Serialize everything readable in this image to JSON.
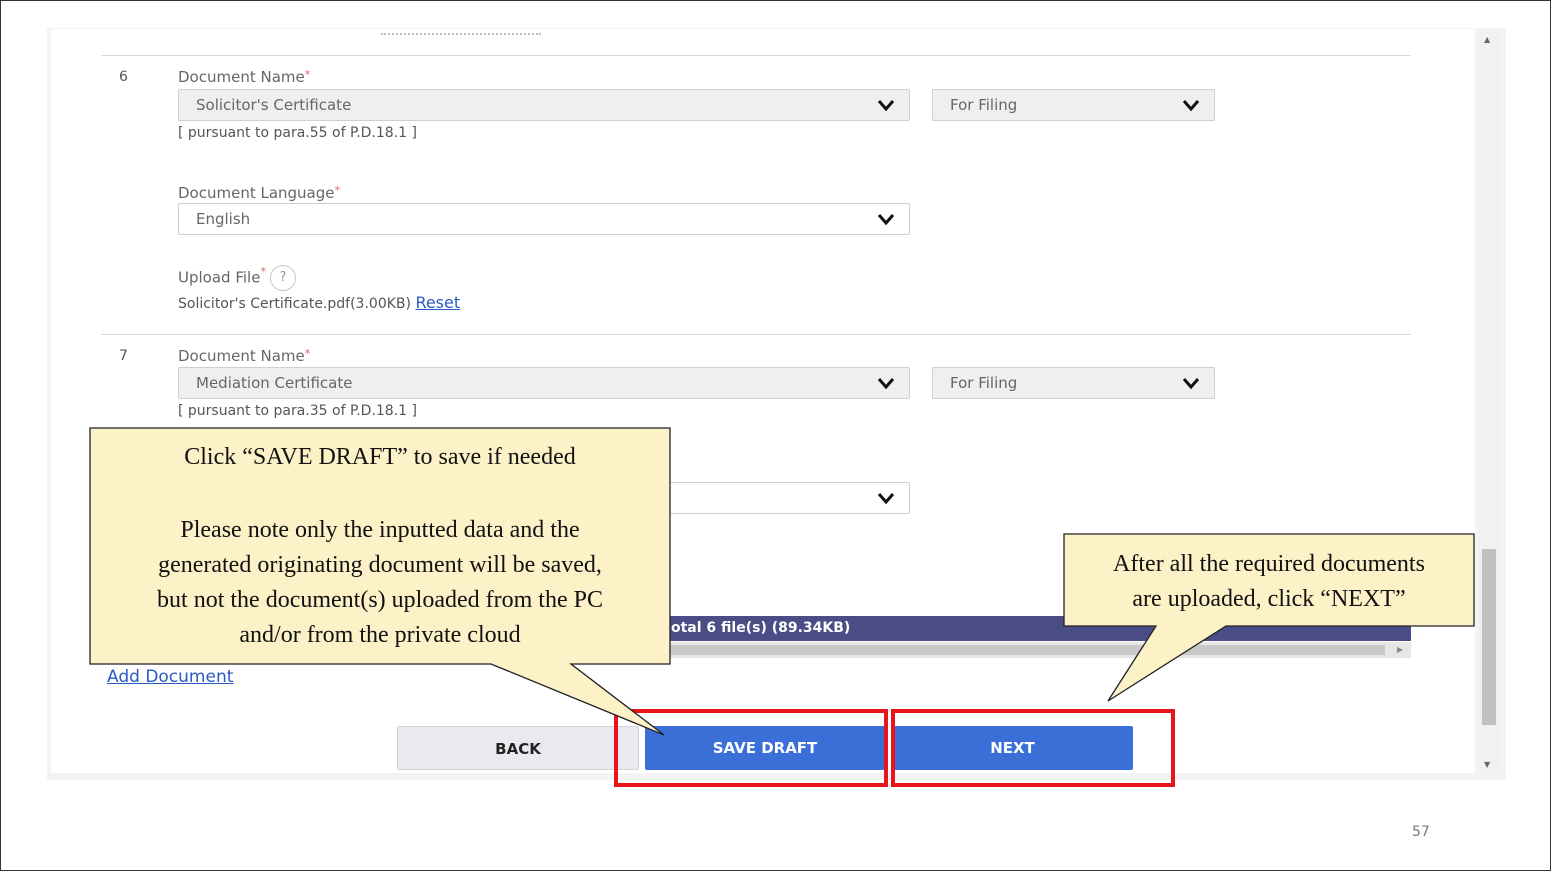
{
  "slide": {
    "page_number": "57"
  },
  "form": {
    "docs": [
      {
        "index": "6",
        "name_label": "Document Name",
        "name_value": "Solicitor's Certificate",
        "purpose_value": "For Filing",
        "note": "[ pursuant to para.55 of P.D.18.1 ]",
        "language_label": "Document Language",
        "language_value": "English",
        "upload_label": "Upload File",
        "help_glyph": "?",
        "file_text": "Solicitor's Certificate.pdf(3.00KB)",
        "reset_label": "Reset"
      },
      {
        "index": "7",
        "name_label": "Document Name",
        "name_value": "Mediation Certificate",
        "purpose_value": "For Filing",
        "note": "[ pursuant to para.35 of P.D.18.1 ]"
      }
    ],
    "required_marker": "*",
    "total_label": "otal 6 file(s) (89.34KB)",
    "add_document_label": "Add Document"
  },
  "buttons": {
    "back": "BACK",
    "save_draft": "SAVE DRAFT",
    "next": "NEXT"
  },
  "callouts": {
    "save": {
      "line1": "Click “SAVE DRAFT” to save if needed",
      "line2": "Please note only the inputted data and the",
      "line3": "generated originating document will be saved,",
      "line4": "but not the document(s) uploaded from the PC",
      "line5": "and/or from the private cloud"
    },
    "next": {
      "line1": "After all the required documents",
      "line2": "are uploaded, click “NEXT”"
    }
  },
  "colors": {
    "primary_button": "#3a6fd8",
    "highlight_box": "#e8141a",
    "callout_fill": "#fdf1c8",
    "total_bar": "#4b4e86",
    "link": "#2b59c3"
  },
  "icons": {
    "dropdown": "chevron-down-icon",
    "help": "help-circle-icon",
    "scroll_up": "scroll-up-arrow-icon",
    "scroll_down": "scroll-down-arrow-icon",
    "scroll_right": "scroll-right-arrow-icon"
  }
}
